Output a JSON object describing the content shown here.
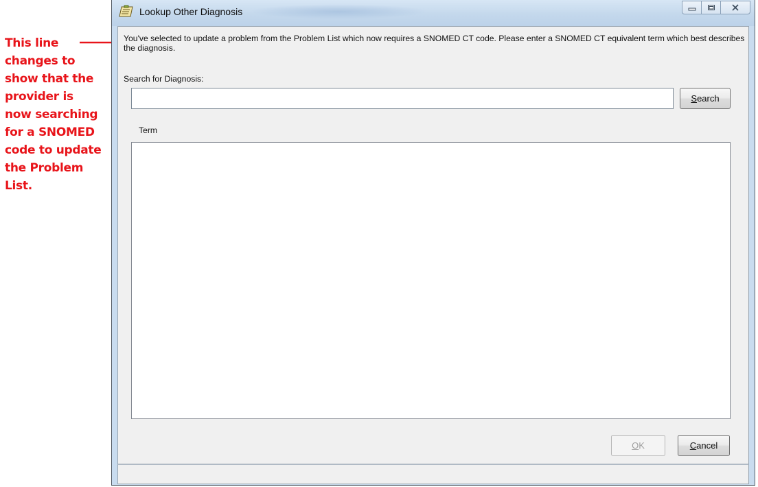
{
  "annotation": {
    "text": "This line\nchanges to\nshow that the\nprovider is\nnow searching\nfor a SNOMED\ncode to update\nthe Problem\nList.",
    "color": "#e8141a"
  },
  "window": {
    "title": "Lookup Other Diagnosis",
    "controls": {
      "minimize": "minimize-icon",
      "maximize": "maximize-icon",
      "close": "close-icon"
    }
  },
  "dialog": {
    "info_text": "You've selected to update a problem from the Problem List which now requires a SNOMED CT code. Please enter a SNOMED CT equivalent term which best describes the diagnosis.",
    "search_label": "Search for Diagnosis:",
    "search_value": "",
    "search_button": {
      "accel": "S",
      "rest": "earch"
    },
    "term_header": "Term",
    "ok_button": {
      "accel": "O",
      "rest": "K",
      "enabled": false
    },
    "cancel_button": {
      "accel": "C",
      "rest": "ancel"
    }
  }
}
